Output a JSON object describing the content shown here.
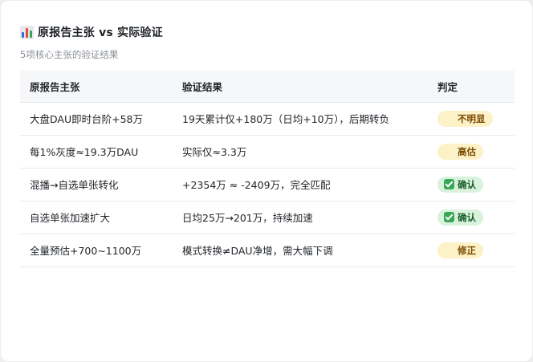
{
  "header": {
    "title_icon": "bar-chart-icon",
    "title": "原报告主张 vs 实际验证",
    "subtitle": "5项核心主张的验证结果"
  },
  "table": {
    "columns": [
      "原报告主张",
      "验证结果",
      "判定"
    ],
    "rows": [
      {
        "claim": "大盘DAU即时台阶+58万",
        "result": "19天累计仅+180万（日均+10万），后期转负",
        "verdict": "不明显",
        "verdict_type": "warning",
        "verdict_icon": "warning-icon"
      },
      {
        "claim": "每1%灰度≈19.3万DAU",
        "result": "实际仅≈3.3万",
        "verdict": "高估",
        "verdict_type": "warning",
        "verdict_icon": "warning-icon"
      },
      {
        "claim": "混播→自选单张转化",
        "result": "+2354万 ≈ -2409万，完全匹配",
        "verdict": "确认",
        "verdict_type": "confirm",
        "verdict_icon": "check-icon"
      },
      {
        "claim": "自选单张加速扩大",
        "result": "日均25万→201万，持续加速",
        "verdict": "确认",
        "verdict_type": "confirm",
        "verdict_icon": "check-icon"
      },
      {
        "claim": "全量预估+700~1100万",
        "result": "模式转换≠DAU净增，需大幅下调",
        "verdict": "修正",
        "verdict_type": "warning",
        "verdict_icon": "warning-icon"
      }
    ]
  },
  "colors": {
    "warning_badge_bg": "#fdf1c7",
    "confirm_badge_bg": "#d8f2dc",
    "header_bg": "#f6f7f9"
  }
}
